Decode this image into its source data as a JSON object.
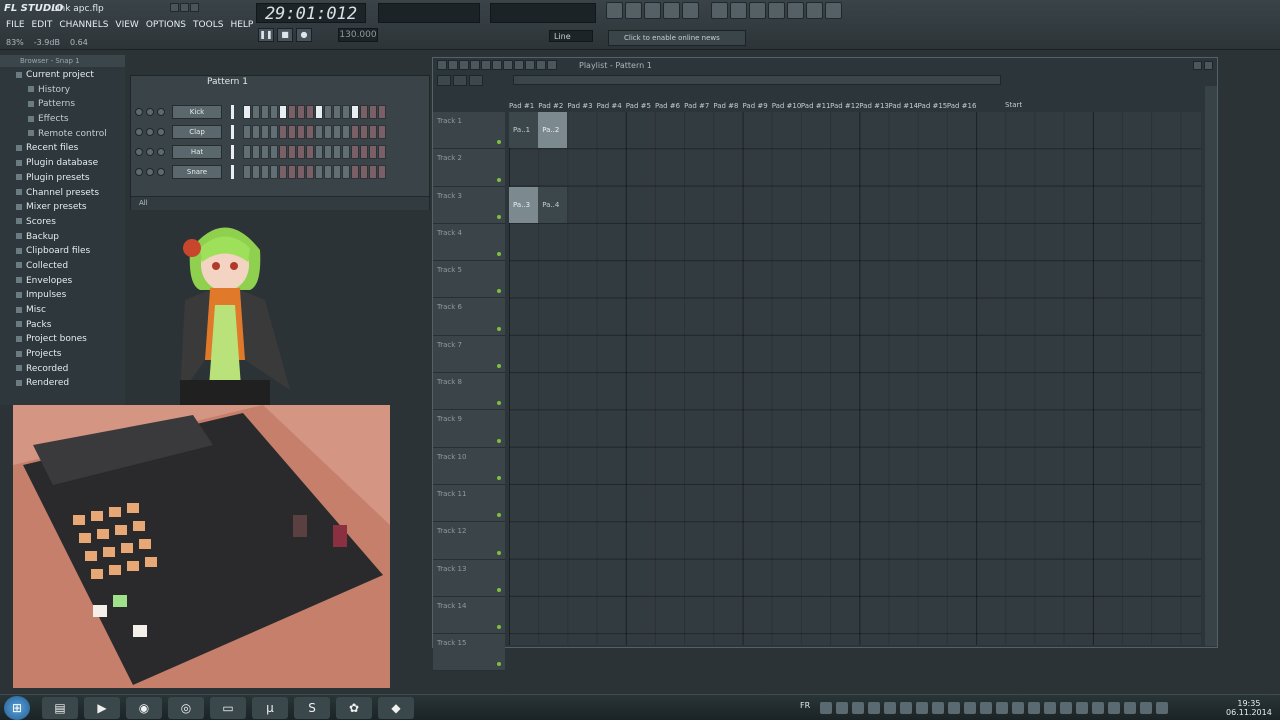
{
  "app": {
    "logo": "FL STUDIO",
    "filename": "Link apc.flp",
    "status_left": "83%",
    "status_db": "-3.9dB",
    "status_val": "0.64"
  },
  "menu": [
    "FILE",
    "EDIT",
    "CHANNELS",
    "VIEW",
    "OPTIONS",
    "TOOLS",
    "HELP"
  ],
  "transport": {
    "time": "29:01:012",
    "bpm": "130.000",
    "line_mode": "Line"
  },
  "online": {
    "label": "Click to enable online news"
  },
  "browser": {
    "title": "Browser - Snap 1",
    "items": [
      {
        "label": "Current project",
        "top": true
      },
      {
        "label": "History",
        "top": false
      },
      {
        "label": "Patterns",
        "top": false
      },
      {
        "label": "Effects",
        "top": false
      },
      {
        "label": "Remote control",
        "top": false
      },
      {
        "label": "Recent files",
        "top": true
      },
      {
        "label": "Plugin database",
        "top": true
      },
      {
        "label": "Plugin presets",
        "top": true
      },
      {
        "label": "Channel presets",
        "top": true
      },
      {
        "label": "Mixer presets",
        "top": true
      },
      {
        "label": "Scores",
        "top": true
      },
      {
        "label": "Backup",
        "top": true
      },
      {
        "label": "Clipboard files",
        "top": true
      },
      {
        "label": "Collected",
        "top": true
      },
      {
        "label": "Envelopes",
        "top": true
      },
      {
        "label": "Impulses",
        "top": true
      },
      {
        "label": "Misc",
        "top": true
      },
      {
        "label": "Packs",
        "top": true
      },
      {
        "label": "Project bones",
        "top": true
      },
      {
        "label": "Projects",
        "top": true
      },
      {
        "label": "Recorded",
        "top": true
      },
      {
        "label": "Rendered",
        "top": true
      }
    ]
  },
  "channel_rack": {
    "title": "Pattern 1",
    "filter": "All",
    "channels": [
      {
        "name": "Kick",
        "steps": [
          1,
          0,
          0,
          0,
          1,
          0,
          0,
          0,
          1,
          0,
          0,
          0,
          1,
          0,
          0,
          0
        ]
      },
      {
        "name": "Clap",
        "steps": [
          0,
          0,
          0,
          0,
          0,
          0,
          0,
          0,
          0,
          0,
          0,
          0,
          0,
          0,
          0,
          0
        ]
      },
      {
        "name": "Hat",
        "steps": [
          0,
          0,
          0,
          0,
          0,
          0,
          0,
          0,
          0,
          0,
          0,
          0,
          0,
          0,
          0,
          0
        ]
      },
      {
        "name": "Snare",
        "steps": [
          0,
          0,
          0,
          0,
          0,
          0,
          0,
          0,
          0,
          0,
          0,
          0,
          0,
          0,
          0,
          0
        ]
      }
    ]
  },
  "playlist": {
    "title": "Playlist - Pattern 1",
    "ruler": [
      "Pad #1",
      "Pad #2",
      "Pad #3",
      "Pad #4",
      "Pad #5",
      "Pad #6",
      "Pad #7",
      "Pad #8",
      "Pad #9",
      "Pad #10",
      "Pad #11",
      "Pad #12",
      "Pad #13",
      "Pad #14",
      "Pad #15",
      "Pad #16"
    ],
    "start_marker": "Start",
    "tracks": [
      "Track 1",
      "Track 2",
      "Track 3",
      "Track 4",
      "Track 5",
      "Track 6",
      "Track 7",
      "Track 8",
      "Track 9",
      "Track 10",
      "Track 11",
      "Track 12",
      "Track 13",
      "Track 14",
      "Track 15"
    ],
    "clips": [
      {
        "label": "Pa..1",
        "track": 0,
        "bar": 0,
        "style": "dark"
      },
      {
        "label": "Pa..2",
        "track": 0,
        "bar": 1,
        "style": "light"
      },
      {
        "label": "Pa..3",
        "track": 2,
        "bar": 0,
        "style": "light"
      },
      {
        "label": "Pa..4",
        "track": 2,
        "bar": 1,
        "style": "dark"
      }
    ]
  },
  "taskbar": {
    "lang": "FR",
    "time": "19:35",
    "date": "06.11.2014"
  }
}
